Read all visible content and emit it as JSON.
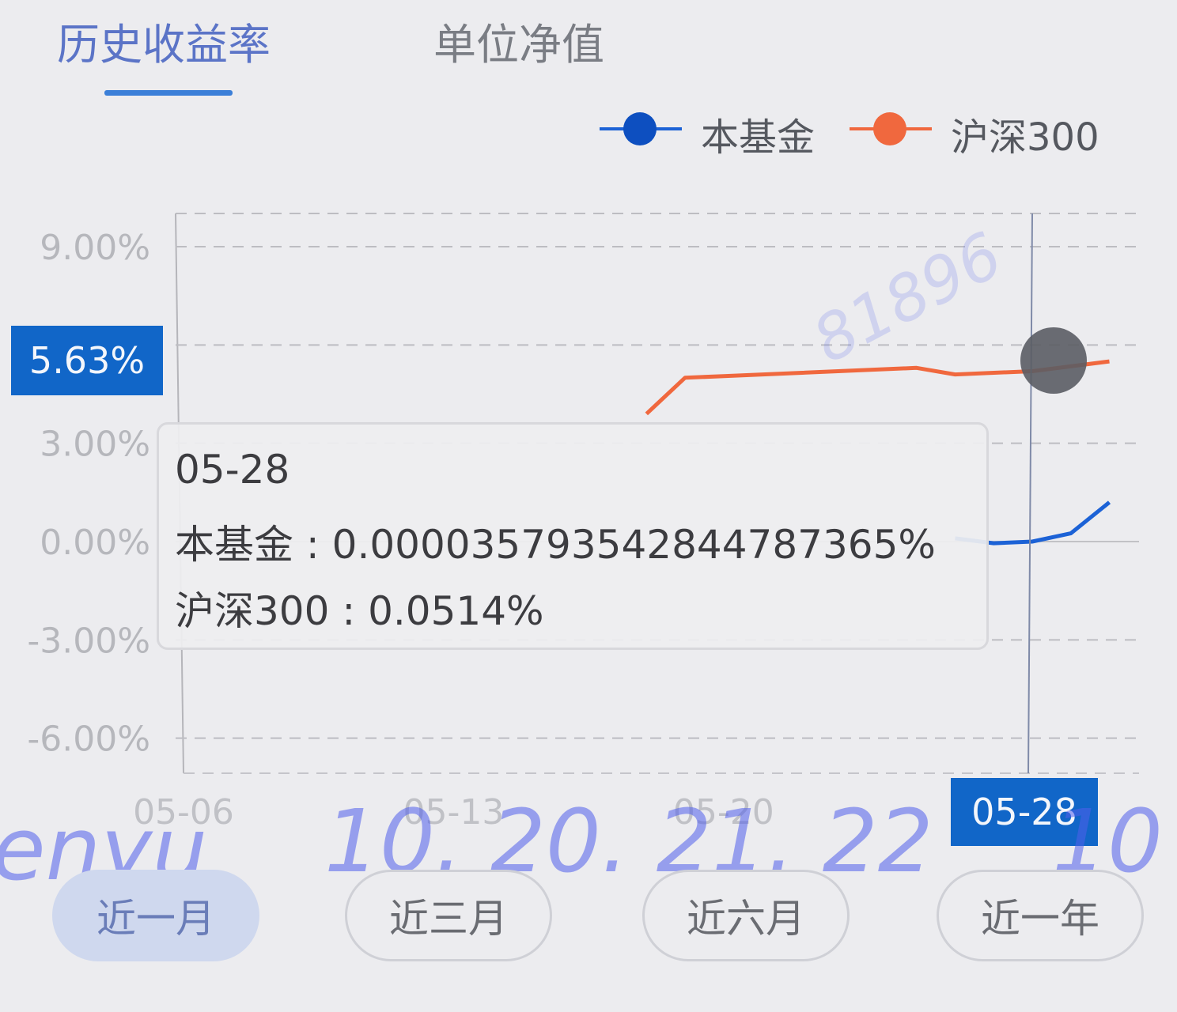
{
  "tabs": [
    {
      "label": "历史收益率",
      "active": true
    },
    {
      "label": "单位净值",
      "active": false
    }
  ],
  "legend": [
    {
      "name": "本基金",
      "color": "#1c62d6"
    },
    {
      "name": "沪深300",
      "color": "#f0683e"
    }
  ],
  "chart_data": {
    "type": "line",
    "x_ticks": [
      "05-06",
      "05-13",
      "05-20",
      "05-28"
    ],
    "y_ticks": [
      "9.00%",
      "3.00%",
      "0.00%",
      "-3.00%",
      "-6.00%"
    ],
    "ylim": [
      -6,
      9
    ],
    "grid": true,
    "legend_position": "top-right",
    "series": [
      {
        "name": "本基金",
        "color": "#1c62d6",
        "points": [
          [
            "05-26",
            0.1
          ],
          [
            "05-27",
            -0.05
          ],
          [
            "05-28",
            3.57935e-05
          ],
          [
            "05-29",
            0.25
          ],
          [
            "05-30",
            1.2
          ]
        ]
      },
      {
        "name": "沪深300",
        "color": "#f0683e",
        "points": [
          [
            "05-18",
            3.9
          ],
          [
            "05-19",
            5.0
          ],
          [
            "05-20",
            5.05
          ],
          [
            "05-25",
            5.3
          ],
          [
            "05-26",
            5.1
          ],
          [
            "05-28",
            5.2
          ],
          [
            "05-30",
            5.5
          ]
        ]
      }
    ],
    "crosshair": {
      "x_label": "05-28",
      "y_label": "5.63%"
    },
    "tooltip": {
      "title": "05-28",
      "rows": [
        {
          "name": "本基金",
          "value": "0.0000357935428447873​65%"
        },
        {
          "name": "沪深300",
          "value": "0.0514%"
        }
      ]
    }
  },
  "tooltip_text": {
    "title": "05-28",
    "fund_line": "本基金 : 0.000035793542844787365%",
    "index_line": "沪深300 : 0.0514%"
  },
  "range_buttons": [
    {
      "label": "近一月",
      "active": true
    },
    {
      "label": "近三月",
      "active": false
    },
    {
      "label": "近六月",
      "active": false
    },
    {
      "label": "近一年",
      "active": false
    }
  ],
  "watermark": {
    "text1": "enyu",
    "text2": "10. 20. 21. 22",
    "text3": "10",
    "text4": "81896"
  }
}
